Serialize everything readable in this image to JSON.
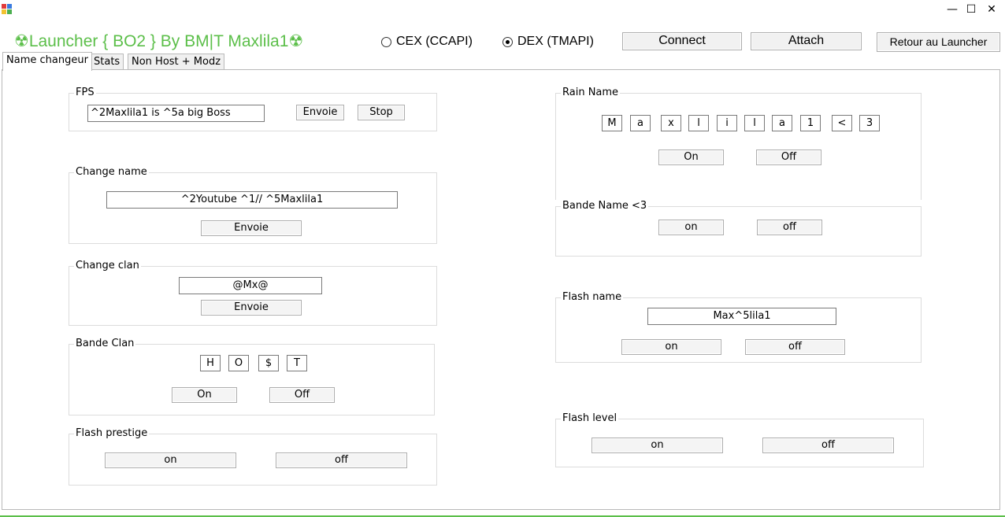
{
  "window": {
    "minimize_glyph": "—",
    "maximize_glyph": "☐",
    "close_glyph": "✕"
  },
  "header": {
    "title": "☢Launcher { BO2 }  By BM|T Maxlila1☢",
    "title_color": "#5cbf4a",
    "radio_cex": "CEX (CCAPI)",
    "radio_dex": "DEX (TMAPI)",
    "selected_api": "DEX (TMAPI)",
    "connect_label": "Connect",
    "attach_label": "Attach",
    "retour_label": "Retour au Launcher"
  },
  "tabs": [
    {
      "label": "Name changeur",
      "active": true
    },
    {
      "label": "Stats",
      "active": false
    },
    {
      "label": "Non Host + Modz",
      "active": false
    }
  ],
  "fps": {
    "title": "FPS",
    "value": "^2Maxlila1 is ^5a big Boss",
    "send_label": "Envoie",
    "stop_label": "Stop"
  },
  "change_name": {
    "title": "Change name",
    "value": "^2Youtube ^1// ^5Maxlila1",
    "send_label": "Envoie"
  },
  "change_clan": {
    "title": "Change clan",
    "value": "@Mx@",
    "send_label": "Envoie"
  },
  "bande_clan": {
    "title": "Bande Clan",
    "letters": [
      "H",
      "O",
      "$",
      "T"
    ],
    "on_label": "On",
    "off_label": "Off"
  },
  "flash_prestige": {
    "title": "Flash prestige",
    "on_label": "on",
    "off_label": "off"
  },
  "rain_name": {
    "title": "Rain Name",
    "letters": [
      "M",
      "a",
      "x",
      "l",
      "i",
      "l",
      "a",
      "1",
      "<",
      "3"
    ],
    "on_label": "On",
    "off_label": "Off"
  },
  "bande_name": {
    "title": "Bande Name <3",
    "on_label": "on",
    "off_label": "off"
  },
  "flash_name": {
    "title": "Flash name",
    "value": "Max^5lila1",
    "on_label": "on",
    "off_label": "off"
  },
  "flash_level": {
    "title": "Flash level",
    "on_label": "on",
    "off_label": "off"
  }
}
